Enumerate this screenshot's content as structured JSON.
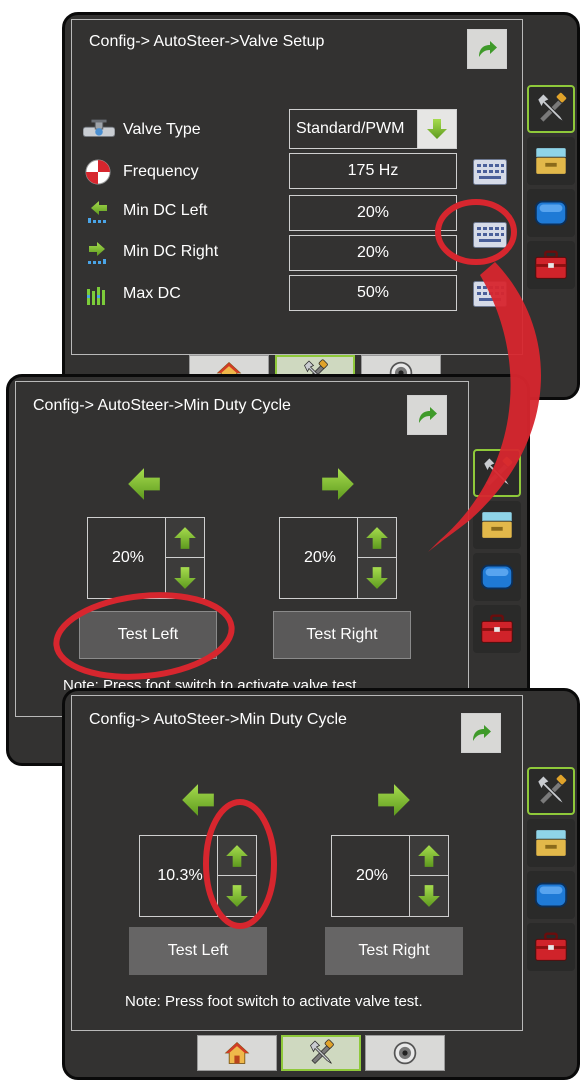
{
  "colors": {
    "device_body": "#333231",
    "panel_border": "#b9b9b9",
    "accent_green": "#8fc93a",
    "callout_red": "#d7262e",
    "text": "#ffffff"
  },
  "screen1": {
    "title": "Config-> AutoSteer->Valve Setup",
    "rows": [
      {
        "icon": "valve-icon",
        "label": "Valve Type",
        "value": "Standard/PWM"
      },
      {
        "icon": "frequency-icon",
        "label": "Frequency",
        "value": "175 Hz"
      },
      {
        "icon": "min-dc-left-icon",
        "label": "Min DC Left",
        "value": "20%"
      },
      {
        "icon": "min-dc-right-icon",
        "label": "Min DC Right",
        "value": "20%"
      },
      {
        "icon": "max-dc-icon",
        "label": "Max DC",
        "value": "50%"
      }
    ]
  },
  "screen2": {
    "title": "Config-> AutoSteer->Min Duty Cycle",
    "left_value": "20%",
    "right_value": "20%",
    "test_left": "Test Left",
    "test_right": "Test Right",
    "note": "Note: Press foot switch to activate valve test."
  },
  "screen3": {
    "title": "Config-> AutoSteer->Min Duty Cycle",
    "left_value": "10.3%",
    "right_value": "20%",
    "test_left": "Test Left",
    "test_right": "Test Right",
    "note": "Note: Press foot switch to activate valve test."
  },
  "side_tabs": [
    "tools-icon",
    "console-icon",
    "monitor-icon",
    "toolbox-icon"
  ],
  "bottom_tabs": [
    "home-icon",
    "tools-icon",
    "gauge-icon"
  ]
}
